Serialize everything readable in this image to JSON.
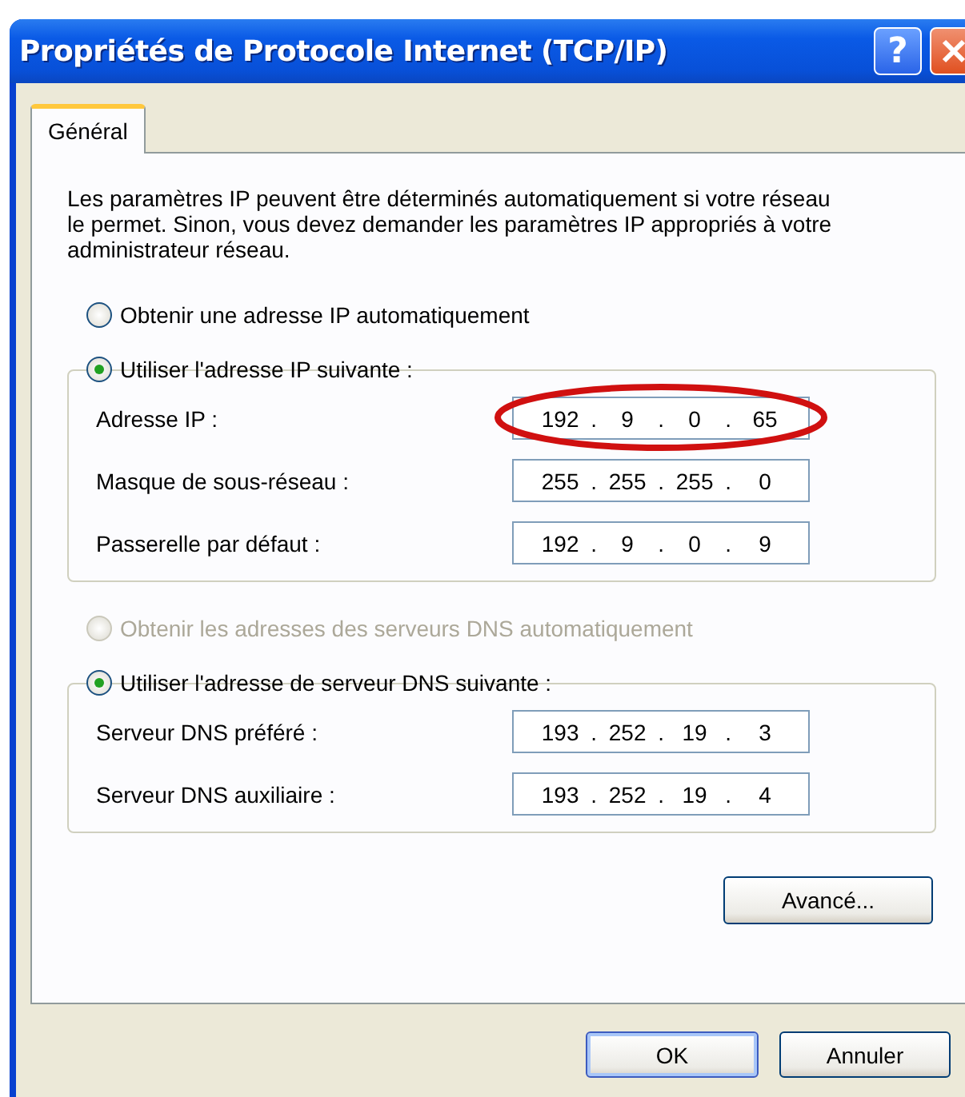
{
  "window": {
    "title": "Propriétés de Protocole Internet (TCP/IP)",
    "buttons": [
      {
        "kind": "help",
        "label": "?"
      },
      {
        "kind": "close"
      }
    ]
  },
  "tabs": [
    {
      "label": "Général",
      "selected": true
    }
  ],
  "description": "Les paramètres IP peuvent être déterminés automatiquement si votre réseau le permet. Sinon, vous devez demander les paramètres IP appropriés à votre administrateur réseau.",
  "sections": [
    {
      "auto_option": {
        "label": "Obtenir une adresse IP automatiquement",
        "selected": false,
        "disabled": false
      },
      "manual_option": {
        "label": "Utiliser l'adresse IP suivante :",
        "selected": true,
        "disabled": false
      },
      "fields": [
        {
          "label": "Adresse IP :",
          "octets": [
            "192",
            "9",
            "0",
            "65"
          ],
          "highlighted": true
        },
        {
          "label": "Masque de sous-réseau :",
          "octets": [
            "255",
            "255",
            "255",
            "0"
          ],
          "highlighted": false
        },
        {
          "label": "Passerelle par défaut :",
          "octets": [
            "192",
            "9",
            "0",
            "9"
          ],
          "highlighted": false
        }
      ]
    },
    {
      "auto_option": {
        "label": "Obtenir les adresses des serveurs DNS automatiquement",
        "selected": false,
        "disabled": true
      },
      "manual_option": {
        "label": "Utiliser l'adresse de serveur DNS suivante :",
        "selected": true,
        "disabled": false
      },
      "fields": [
        {
          "label": "Serveur DNS préféré :",
          "octets": [
            "193",
            "252",
            "19",
            "3"
          ],
          "highlighted": false
        },
        {
          "label": "Serveur DNS auxiliaire :",
          "octets": [
            "193",
            "252",
            "19",
            "4"
          ],
          "highlighted": false
        }
      ]
    }
  ],
  "octet_separator": ".",
  "advanced_button": "Avancé...",
  "buttons": [
    "OK",
    "Annuler"
  ]
}
